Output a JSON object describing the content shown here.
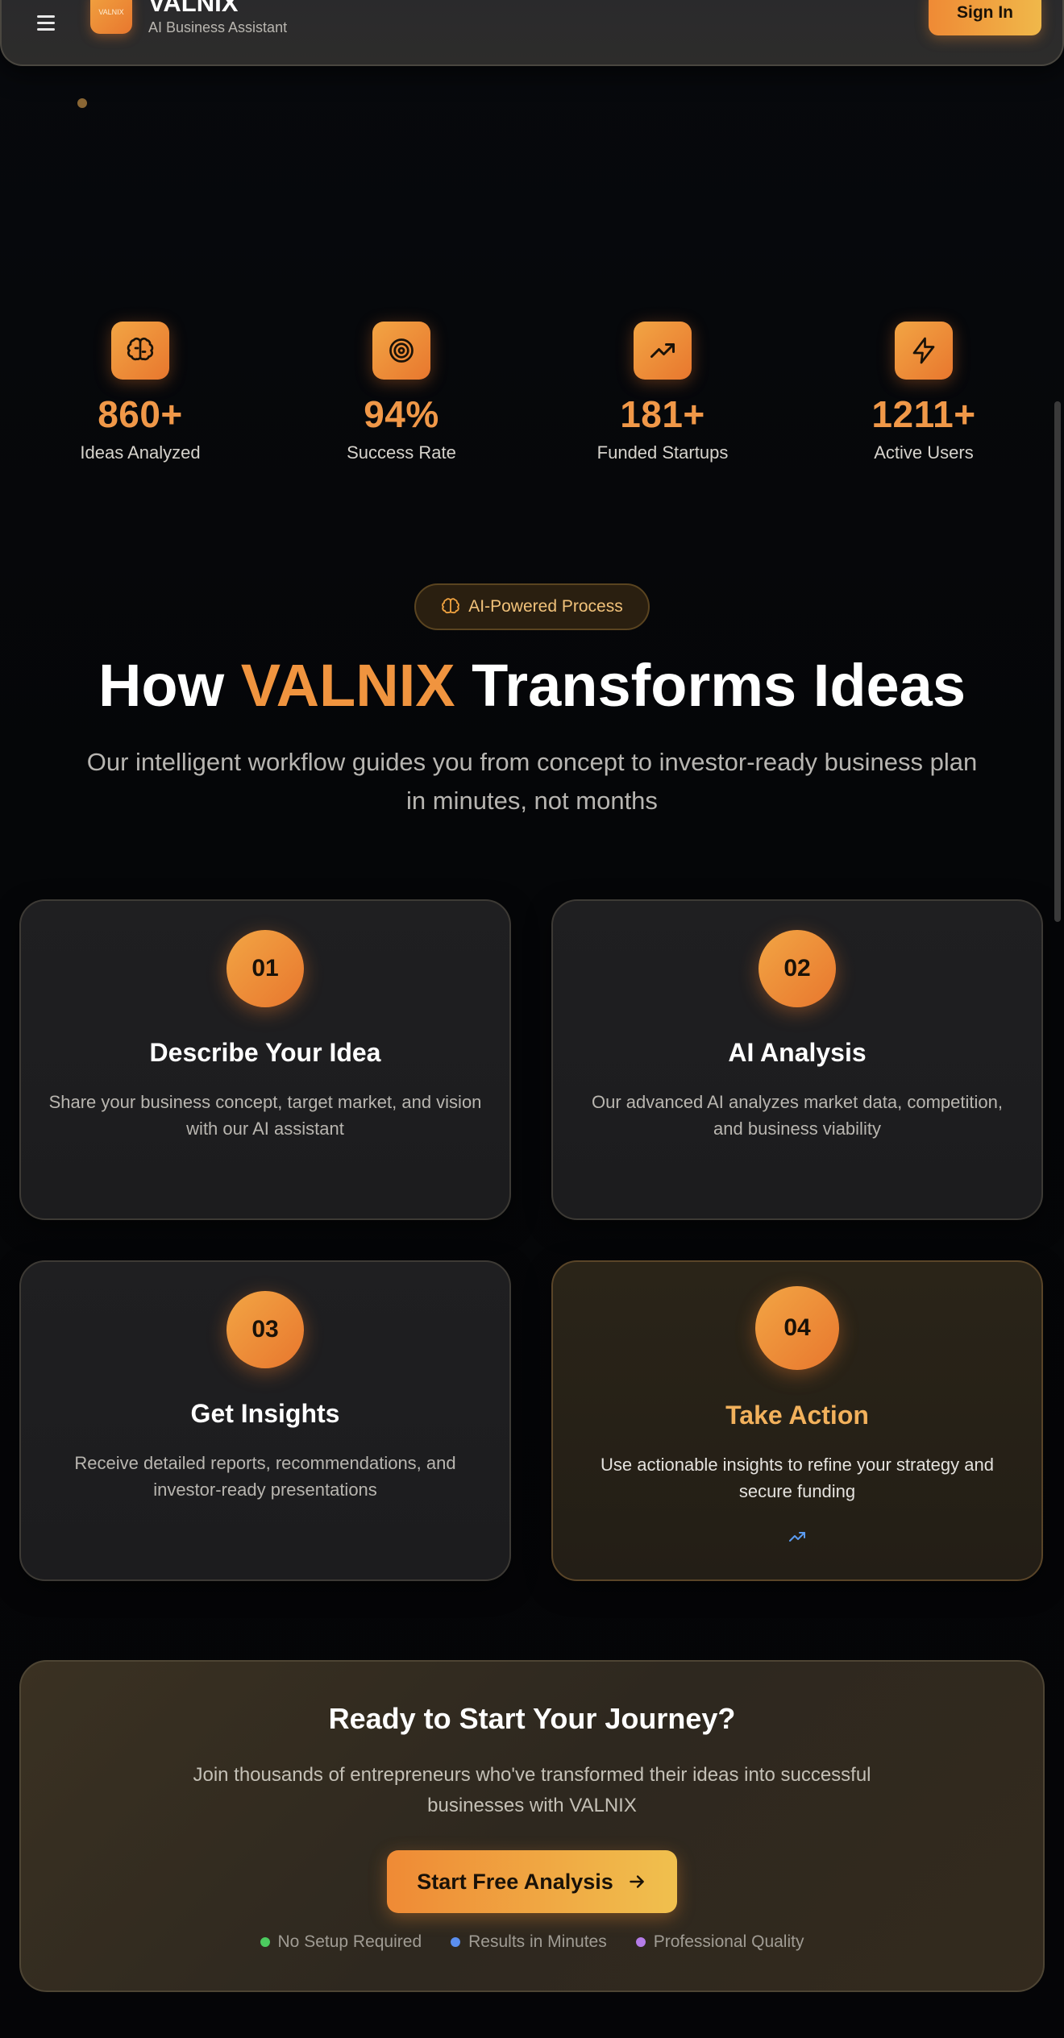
{
  "header": {
    "brand_title": "VALNIX",
    "brand_subtitle": "AI Business Assistant",
    "logo_text": "VALNIX",
    "signin_label": "Sign In"
  },
  "stats": [
    {
      "icon": "brain-icon",
      "value": "860+",
      "label": "Ideas Analyzed"
    },
    {
      "icon": "target-icon",
      "value": "94%",
      "label": "Success Rate"
    },
    {
      "icon": "trending-up-icon",
      "value": "181+",
      "label": "Funded Startups"
    },
    {
      "icon": "lightning-icon",
      "value": "1211+",
      "label": "Active Users"
    }
  ],
  "process": {
    "badge": "AI-Powered Process",
    "headline_pre": "How ",
    "headline_accent": "VALNIX",
    "headline_post": " Transforms Ideas",
    "subtitle": "Our intelligent workflow guides you from concept to investor-ready business plan in minutes, not months"
  },
  "steps": [
    {
      "number": "01",
      "title": "Describe Your Idea",
      "description": "Share your business concept, target market, and vision with our AI assistant"
    },
    {
      "number": "02",
      "title": "AI Analysis",
      "description": "Our advanced AI analyzes market data, competition, and business viability"
    },
    {
      "number": "03",
      "title": "Get Insights",
      "description": "Receive detailed reports, recommendations, and investor-ready presentations"
    },
    {
      "number": "04",
      "title": "Take Action",
      "description": "Use actionable insights to refine your strategy and secure funding"
    }
  ],
  "cta": {
    "title": "Ready to Start Your Journey?",
    "description": "Join thousands of entrepreneurs who've transformed their ideas into successful businesses with VALNIX",
    "button_label": "Start Free Analysis",
    "features": [
      {
        "label": "No Setup Required",
        "color": "#4ccb5f"
      },
      {
        "label": "Results in Minutes",
        "color": "#5b8ff0"
      },
      {
        "label": "Professional Quality",
        "color": "#b57ce8"
      }
    ]
  },
  "colors": {
    "accent": "#f0943f",
    "background": "#050608",
    "card": "#1f1f21"
  }
}
